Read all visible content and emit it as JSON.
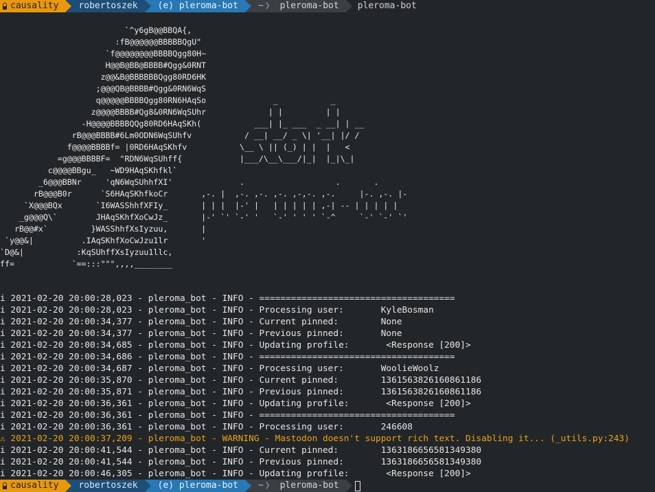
{
  "prompt": {
    "segments": {
      "cause": "causality",
      "user": "robertoszek",
      "venv": "(e) pleroma-bot",
      "tilde": "~",
      "dir": "pleroma-bot",
      "cmd": "pleroma-bot"
    },
    "icons": {
      "lock": "lock-icon"
    }
  },
  "banner": {
    "ascii": "                          `^y6gB@@BBQA{,\n                        :fB@@@@@@BBBBBQgU\"\n                      `f@@@@@@@@BBBBQgg80H~\n                      H@@B@BB@BBBB#Qgg&0RNT\n                     z@@&B@BBBBBBQgg80RD6HK\n                    ;@@@QB@BBBB#Qgg&0RN6WqS\n                    q@@@@@BBBBQgg80RN6HAqSo              _           _\n                   z@@@@BBBB#Qg8&0RN6WqSUhr             | |         | |\n                 -H@@@@BBBBQQg80RD6HAqSKh(           ___| |_ ___  _ __| | __\n               rB@@@BBBB#6Lm0ODN6WqSUhfv           / __| __/ _ \\| '__| |/ /\n              f@@@@BBBBf= |0RD6HAqSKhfv           \\__ \\ || (_) | |  |   <\n            =g@@@BBBBF=  \"RDN6WqSUhff{            |___/\\__\\___/|_|  |_|\\_|\n          c@@@@BBgu_   ~WD9HAqSKhfkl`\n        _6@@@BBNr     'qN6WqSUhhfXI'              .                   .       .\n       rB@@@B0r      `S6HAqSKhfkoCr       ,-. |  ,-. ,-. ,-. ,-,-. ,-.     |-. ,-. |-\n     `X@@@BQx       `I6WASShhfXFIy_       | | |  |-' |   | | | | | ,-| -- | | | | |\n    _g@@@Q\\`        JHAqSKhfXoCwJz_       |-' `' `-' '   `-' ' ' ' `-^     `-' `-' `'\n   rB@@#x`         }WASShhfXsIyzuu,       |\n `y@@&|          .IAqSKhfXoCwJzu1lr       '\n`D@&|           :KqSUhffXsIyzuu1llc,\nff=            `==:::\"\"\",,,,________"
  },
  "log": {
    "warn_glyph": "⚠",
    "info_glyph": "i",
    "lines": [
      {
        "level": "info",
        "text": "2021-02-20 20:00:28,023 - pleroma_bot - INFO - ====================================="
      },
      {
        "level": "info",
        "text": "2021-02-20 20:00:28,023 - pleroma_bot - INFO - Processing user:       KyleBosman"
      },
      {
        "level": "info",
        "text": "2021-02-20 20:00:34,377 - pleroma_bot - INFO - Current pinned:        None"
      },
      {
        "level": "info",
        "text": "2021-02-20 20:00:34,377 - pleroma_bot - INFO - Previous pinned:       None"
      },
      {
        "level": "info",
        "text": "2021-02-20 20:00:34,685 - pleroma_bot - INFO - Updating profile:       <Response [200]>"
      },
      {
        "level": "info",
        "text": "2021-02-20 20:00:34,686 - pleroma_bot - INFO - ====================================="
      },
      {
        "level": "info",
        "text": "2021-02-20 20:00:34,687 - pleroma_bot - INFO - Processing user:       WoolieWoolz"
      },
      {
        "level": "info",
        "text": "2021-02-20 20:00:35,870 - pleroma_bot - INFO - Current pinned:        1361563826160861186"
      },
      {
        "level": "info",
        "text": "2021-02-20 20:00:35,871 - pleroma_bot - INFO - Previous pinned:       1361563826160861186"
      },
      {
        "level": "info",
        "text": "2021-02-20 20:00:36,361 - pleroma_bot - INFO - Updating profile:       <Response [200]>"
      },
      {
        "level": "info",
        "text": "2021-02-20 20:00:36,361 - pleroma_bot - INFO - ====================================="
      },
      {
        "level": "info",
        "text": "2021-02-20 20:00:36,361 - pleroma_bot - INFO - Processing user:       246608"
      },
      {
        "level": "warn",
        "text": "2021-02-20 20:00:37,209 - pleroma_bot - WARNING - Mastodon doesn't support rich text. Disabling it... (_utils.py:243)"
      },
      {
        "level": "info",
        "text": "2021-02-20 20:00:41,544 - pleroma_bot - INFO - Current pinned:        1363186656581349380"
      },
      {
        "level": "info",
        "text": "2021-02-20 20:00:41,544 - pleroma_bot - INFO - Previous pinned:       1363186656581349380"
      },
      {
        "level": "info",
        "text": "2021-02-20 20:00:46,305 - pleroma_bot - INFO - Updating profile:       <Response [200]>"
      }
    ]
  },
  "colors": {
    "background": "#232629",
    "text": "#e6e6e6",
    "warning": "#e8a317",
    "segment_cause": "#e8970f",
    "segment_user": "#1d4e77",
    "segment_venv": "#2778b4",
    "segment_path": "#3b3f44"
  }
}
